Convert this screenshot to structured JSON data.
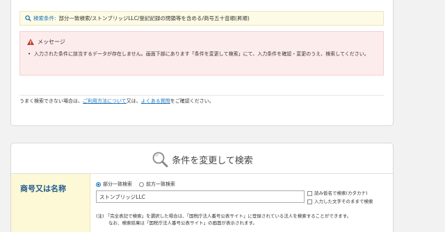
{
  "result": {
    "condition_label": "検索条件:",
    "condition_value": "部分一致検索/ストンブリッジLLC/登記記録の閉鎖等を含める/商号五十音順(昇順)",
    "message_title": "メッセージ",
    "message_body": "入力された条件に該当するデータが存在しません。画面下部にあります「条件を変更して検索」にて、入力条件を確認・変更のうえ、検索してください。",
    "help_prefix": "うまく検索できない場合は、",
    "help_link1": "ご利用方法について",
    "help_mid": "又は、",
    "help_link2": "よくある質問",
    "help_suffix": "をご確認ください。"
  },
  "search_form": {
    "title": "条件を変更して検索",
    "field_label": "商号又は名称",
    "radio_partial": "部分一致検索",
    "radio_prefix": "前方一致検索",
    "selected_radio": "部分一致検索",
    "name_value": "ストンブリッジLLC",
    "check_kana": "読み仮名で検索(カタカナ)",
    "check_exact": "入力した文字そのままで検索",
    "note_line1": "(注) 「完全表記で検索」を選択した場合は、「国税庁法人番号公表サイト」に登録されている法人を検索することができます。",
    "note_line2": "なお、検索結果は「国税庁法人番号公表サイト」の画面が表示されます。"
  },
  "colors": {
    "link": "#1a73b8",
    "label_text": "#1f5a8f",
    "label_bg": "#fdf8d5",
    "error_bg": "#fdecec",
    "warn_icon": "#c0392b"
  },
  "icons": [
    "search-icon",
    "warning-icon",
    "large-search-icon"
  ]
}
